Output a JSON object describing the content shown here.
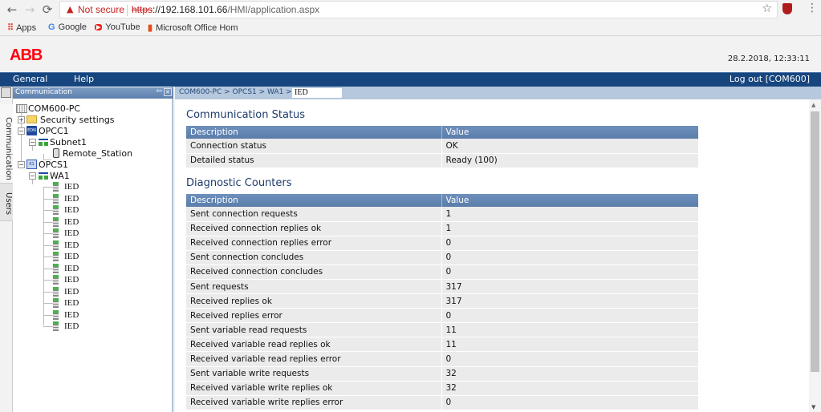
{
  "browser": {
    "back_icon": "←",
    "forward_icon": "→",
    "reload_icon": "⟳",
    "security_label": "Not secure",
    "url_scheme": "https",
    "url_host": "://192.168.101.66",
    "url_path": "/HMI/application.aspx",
    "bookmarks": [
      {
        "label": "Apps",
        "icon": "apps-grid"
      },
      {
        "label": "Google",
        "icon": "google-g"
      },
      {
        "label": "YouTube",
        "icon": "youtube-play"
      },
      {
        "label": "Microsoft Office Hom",
        "icon": "office"
      }
    ]
  },
  "header": {
    "logo": "ABB",
    "datetime": "28.2.2018, 12:33:11"
  },
  "menu": {
    "items": [
      "General",
      "Help"
    ],
    "logout": "Log out [COM600]"
  },
  "side_tabs": [
    "Communication",
    "Users"
  ],
  "panel": {
    "title": "Communication",
    "tree": {
      "root": "COM600-PC",
      "security": "Security settings",
      "opcc": "OPCC1",
      "subnet": "Subnet1",
      "station": "Remote_Station",
      "opcs": "OPCS1",
      "wa": "WA1",
      "ieds": [
        "IED",
        "IED",
        "IED",
        "IED",
        "IED",
        "IED",
        "IED",
        "IED",
        "IED",
        "IED",
        "IED",
        "IED",
        "IED"
      ]
    }
  },
  "breadcrumb": {
    "path": "COM600-PC > OPCS1 > WA1 >",
    "current": "IED"
  },
  "comm_status": {
    "title": "Communication Status",
    "headers": [
      "Description",
      "Value"
    ],
    "rows": [
      [
        "Connection status",
        "OK"
      ],
      [
        "Detailed status",
        "Ready (100)"
      ]
    ]
  },
  "diag": {
    "title": "Diagnostic Counters",
    "headers": [
      "Description",
      "Value"
    ],
    "rows": [
      [
        "Sent connection requests",
        "1"
      ],
      [
        "Received connection replies ok",
        "1"
      ],
      [
        "Received connection replies error",
        "0"
      ],
      [
        "Sent connection concludes",
        "0"
      ],
      [
        "Received connection concludes",
        "0"
      ],
      [
        "Sent requests",
        "317"
      ],
      [
        "Received replies ok",
        "317"
      ],
      [
        "Received replies error",
        "0"
      ],
      [
        "Sent variable read requests",
        "11"
      ],
      [
        "Received variable read replies ok",
        "11"
      ],
      [
        "Received variable read replies error",
        "0"
      ],
      [
        "Sent variable write requests",
        "32"
      ],
      [
        "Received variable write replies ok",
        "32"
      ],
      [
        "Received variable write replies error",
        "0"
      ]
    ]
  }
}
